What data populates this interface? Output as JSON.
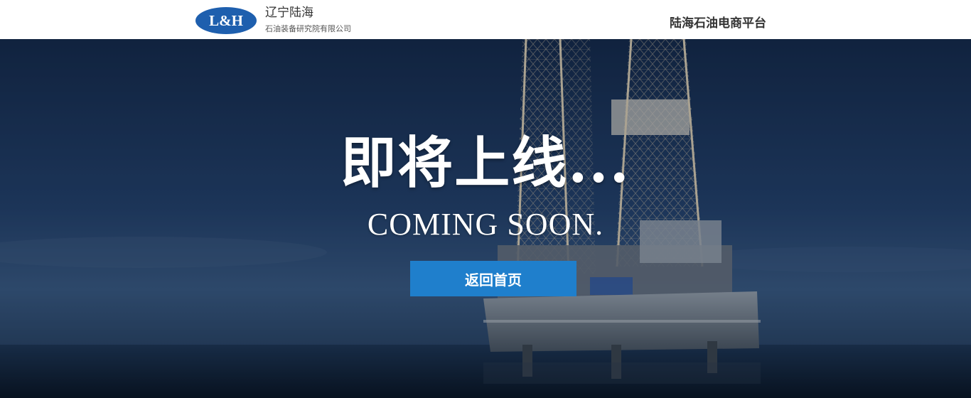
{
  "header": {
    "logo_mark": "L&H",
    "company_name": "辽宁陆海",
    "company_subtitle": "石油装备研究院有限公司",
    "platform_name": "陆海石油电商平台"
  },
  "hero": {
    "headline_cn": "即将上线...",
    "headline_en": "COMING SOON.",
    "home_button_label": "返回首页"
  },
  "colors": {
    "logo_blue": "#1e5fae",
    "button_blue": "#1f7fcc",
    "header_bg": "#ffffff",
    "hero_bg": "#15294a"
  }
}
